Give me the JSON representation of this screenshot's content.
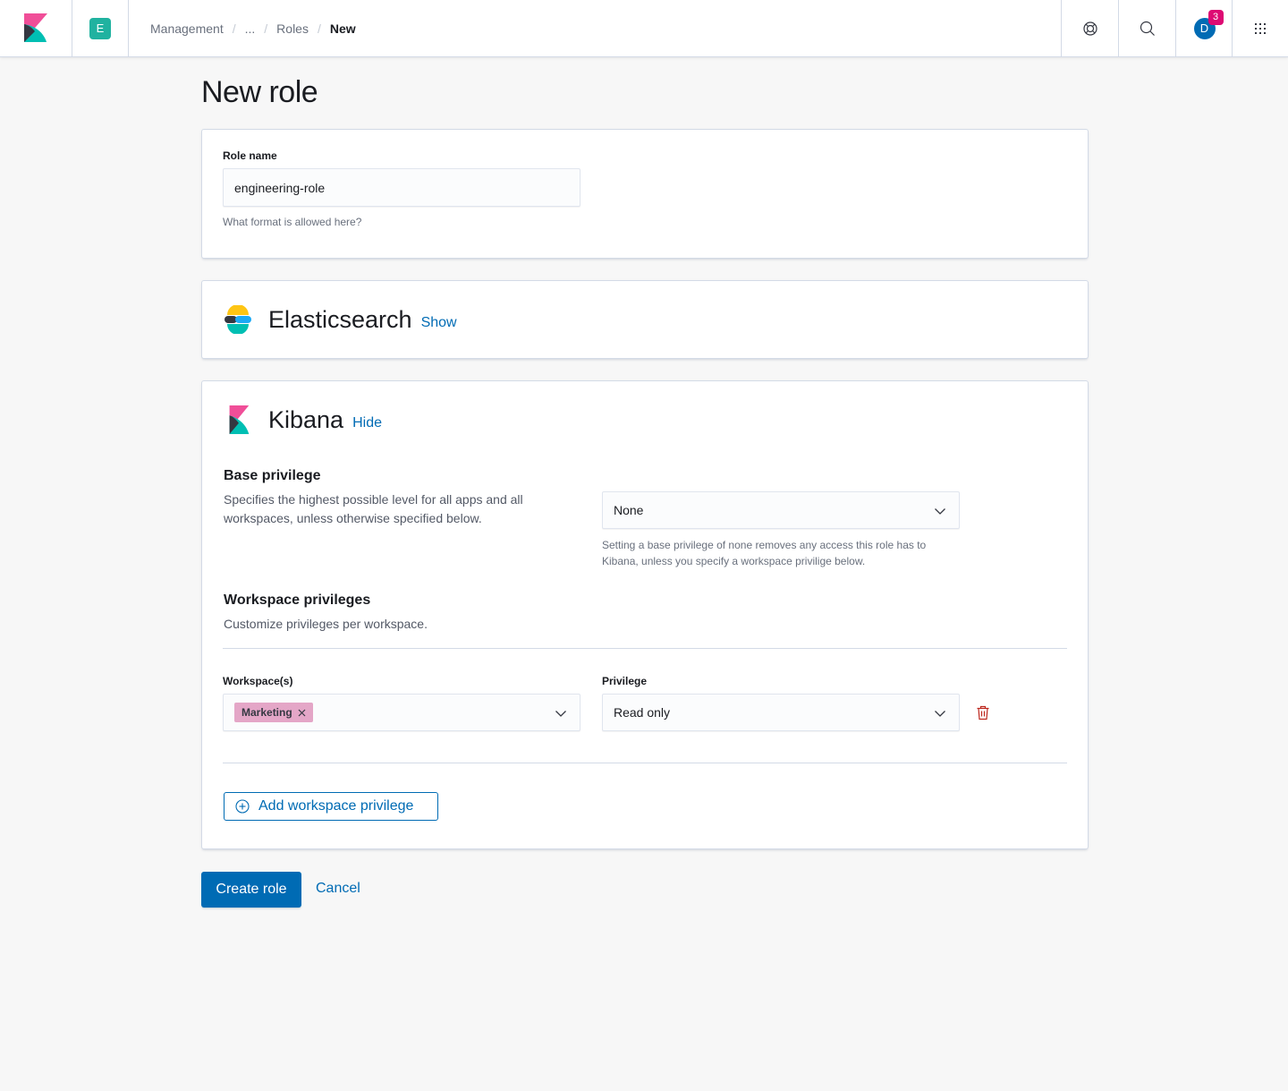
{
  "header": {
    "space_initial": "E",
    "breadcrumbs": [
      "Management",
      "...",
      "Roles"
    ],
    "breadcrumb_current": "New",
    "user_initial": "D",
    "notification_count": "3",
    "icons": {
      "logo": "kibana-logo",
      "help": "help-lifebuoy-icon",
      "search": "search-icon",
      "apps": "apps-grid-icon"
    }
  },
  "page": {
    "title": "New role"
  },
  "role_name": {
    "label": "Role name",
    "value": "engineering-role",
    "help": "What format is allowed here?"
  },
  "elasticsearch": {
    "title": "Elasticsearch",
    "toggle": "Show"
  },
  "kibana": {
    "title": "Kibana",
    "toggle": "Hide",
    "base_privilege": {
      "title": "Base privilege",
      "description": "Specifies the highest possible level for all apps and all workspaces, unless otherwise specified below.",
      "selected": "None",
      "help": "Setting a base privilege of none removes any access this role has to Kibana, unless you specify a workspace privilige below."
    },
    "workspace_privileges": {
      "title": "Workspace privileges",
      "description": "Customize privileges per workspace.",
      "workspaces_label": "Workspace(s)",
      "privilege_label": "Privilege",
      "rows": [
        {
          "workspace": "Marketing",
          "privilege": "Read only"
        }
      ],
      "add_button": "Add workspace privilege"
    }
  },
  "actions": {
    "create": "Create role",
    "cancel": "Cancel"
  },
  "colors": {
    "primary": "#006bb4",
    "danger": "#bd271e",
    "space_avatar": "#20b2a0",
    "pill": "#e4a6c7",
    "badge": "#dd0a73"
  }
}
